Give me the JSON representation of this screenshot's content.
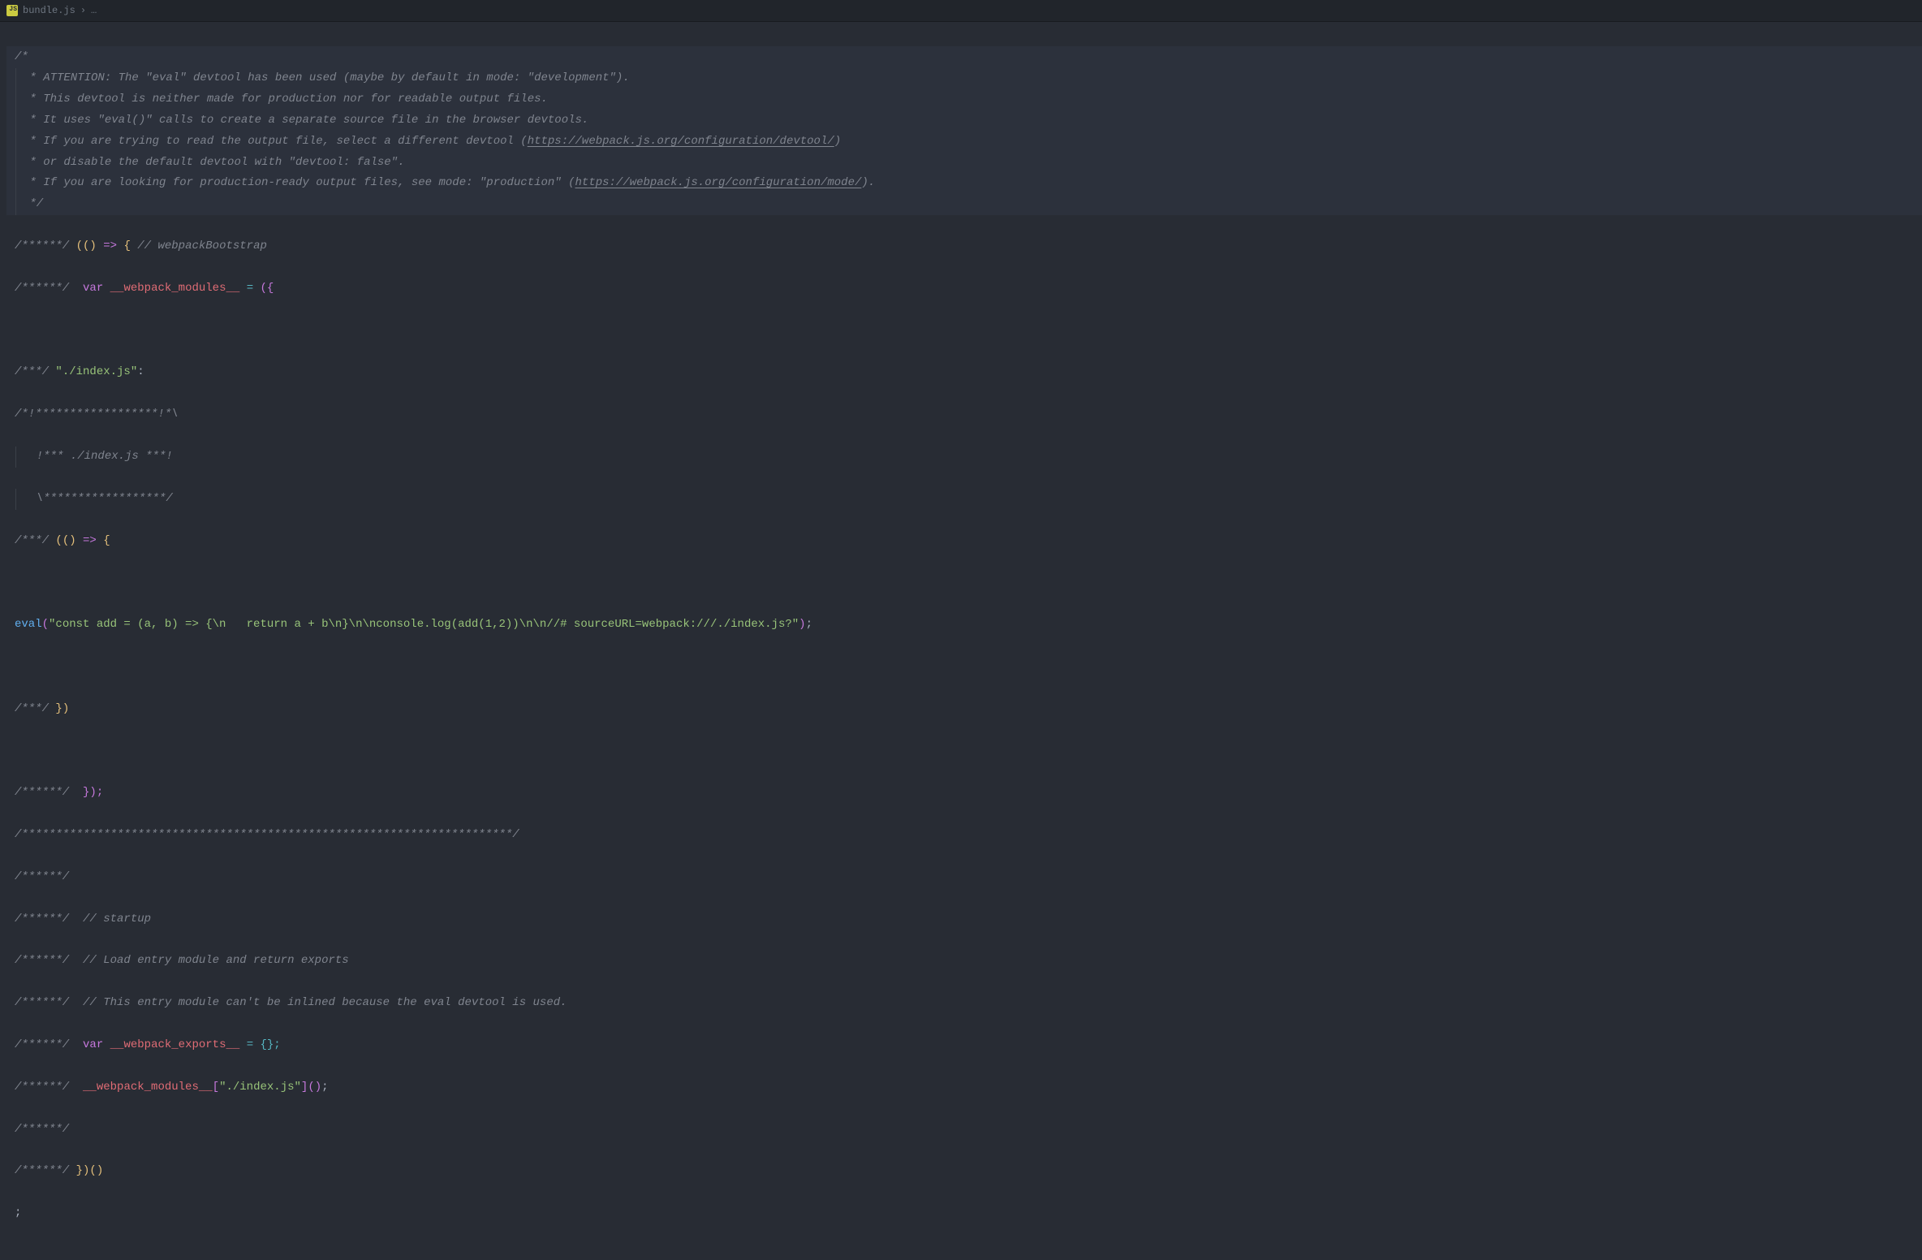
{
  "breadcrumb": {
    "filename": "bundle.js",
    "separator": "›",
    "ellipsis": "…",
    "icon_label": "JS"
  },
  "comment_header": {
    "open": "/*",
    "l1_prefix": " * ATTENTION: The \"eval\" devtool has been used (maybe by default in mode: \"development\").",
    "l2": " * This devtool is neither made for production nor for readable output files.",
    "l3": " * It uses \"eval()\" calls to create a separate source file in the browser devtools.",
    "l4_prefix": " * If you are trying to read the output file, select a different devtool (",
    "l4_link": "https://webpack.js.org/configuration/devtool/",
    "l4_suffix": ")",
    "l5": " * or disable the default devtool with \"devtool: false\".",
    "l6_prefix": " * If you are looking for production-ready output files, see mode: \"production\" (",
    "l6_link": "https://webpack.js.org/configuration/mode/",
    "l6_suffix": ").",
    "close": " */"
  },
  "code": {
    "bootstrap_marker": "/******/",
    "bootstrap_open_comment": " // webpackBootstrap",
    "var_kw": "var",
    "webpack_modules": "__webpack_modules__",
    "eq": " = ",
    "module_marker": "/***/",
    "module_key": "\"./index.js\"",
    "colon": ":",
    "decor1": "/*!******************!*\\",
    "decor2": "  !*** ./index.js ***!",
    "decor3": "  \\******************/",
    "arrow_open": " (() ",
    "arrow": "=>",
    "brace_open": " {",
    "eval_fn": "eval",
    "eval_str": "\"const add = (a, b) => {\\n   return a + b\\n}\\n\\nconsole.log(add(1,2))\\n\\n//# sourceURL=webpack:///./index.js?\"",
    "module_close": " })",
    "modules_close": "  });",
    "separator_comment": "/************************************************************************/",
    "startup_c1": "  // startup",
    "startup_c2": "  // Load entry module and return exports",
    "startup_c3": "  // This entry module can't be inlined because the eval devtool is used.",
    "webpack_exports": "__webpack_exports__",
    "exports_init": " = {};",
    "modules_invoke_key": "\"./index.js\"",
    "iife_close": " })()",
    "semicolon": ";"
  }
}
